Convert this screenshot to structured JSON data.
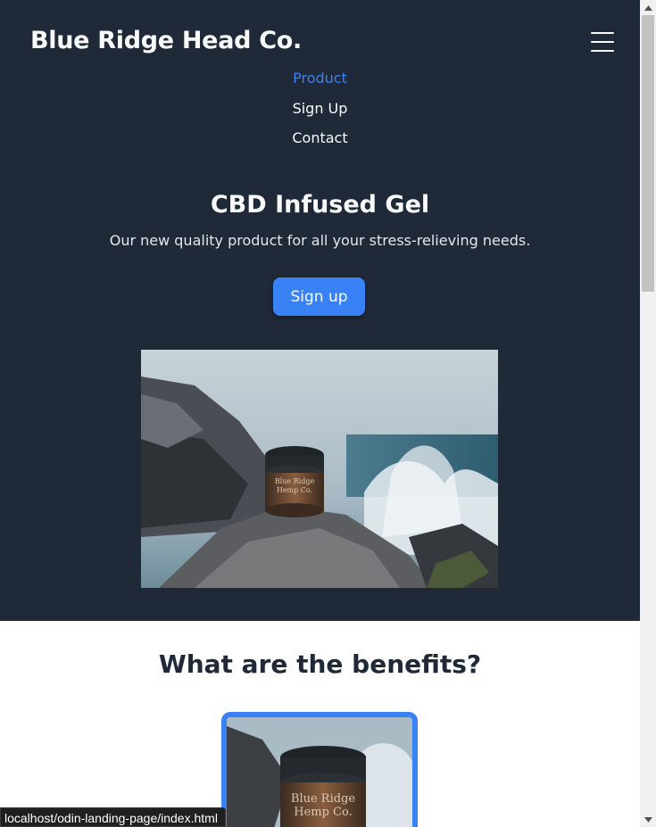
{
  "header": {
    "brand": "Blue Ridge Head Co.",
    "menu_icon": "hamburger-icon"
  },
  "nav": {
    "items": [
      {
        "label": "Product",
        "active": true
      },
      {
        "label": "Sign Up",
        "active": false
      },
      {
        "label": "Contact",
        "active": false
      }
    ]
  },
  "hero": {
    "title": "CBD Infused Gel",
    "subtitle": "Our new quality product for all your stress-relieving needs.",
    "button_label": "Sign up",
    "image_label": "Blue Ridge Hemp Co."
  },
  "benefits": {
    "title": "What are the benefits?"
  },
  "status_bar": {
    "url": "localhost/odin-landing-page/index.html"
  },
  "colors": {
    "hero_bg": "#1f2937",
    "accent": "#3882f6",
    "text_light": "#f9fafb",
    "text_dark": "#1f2937"
  }
}
